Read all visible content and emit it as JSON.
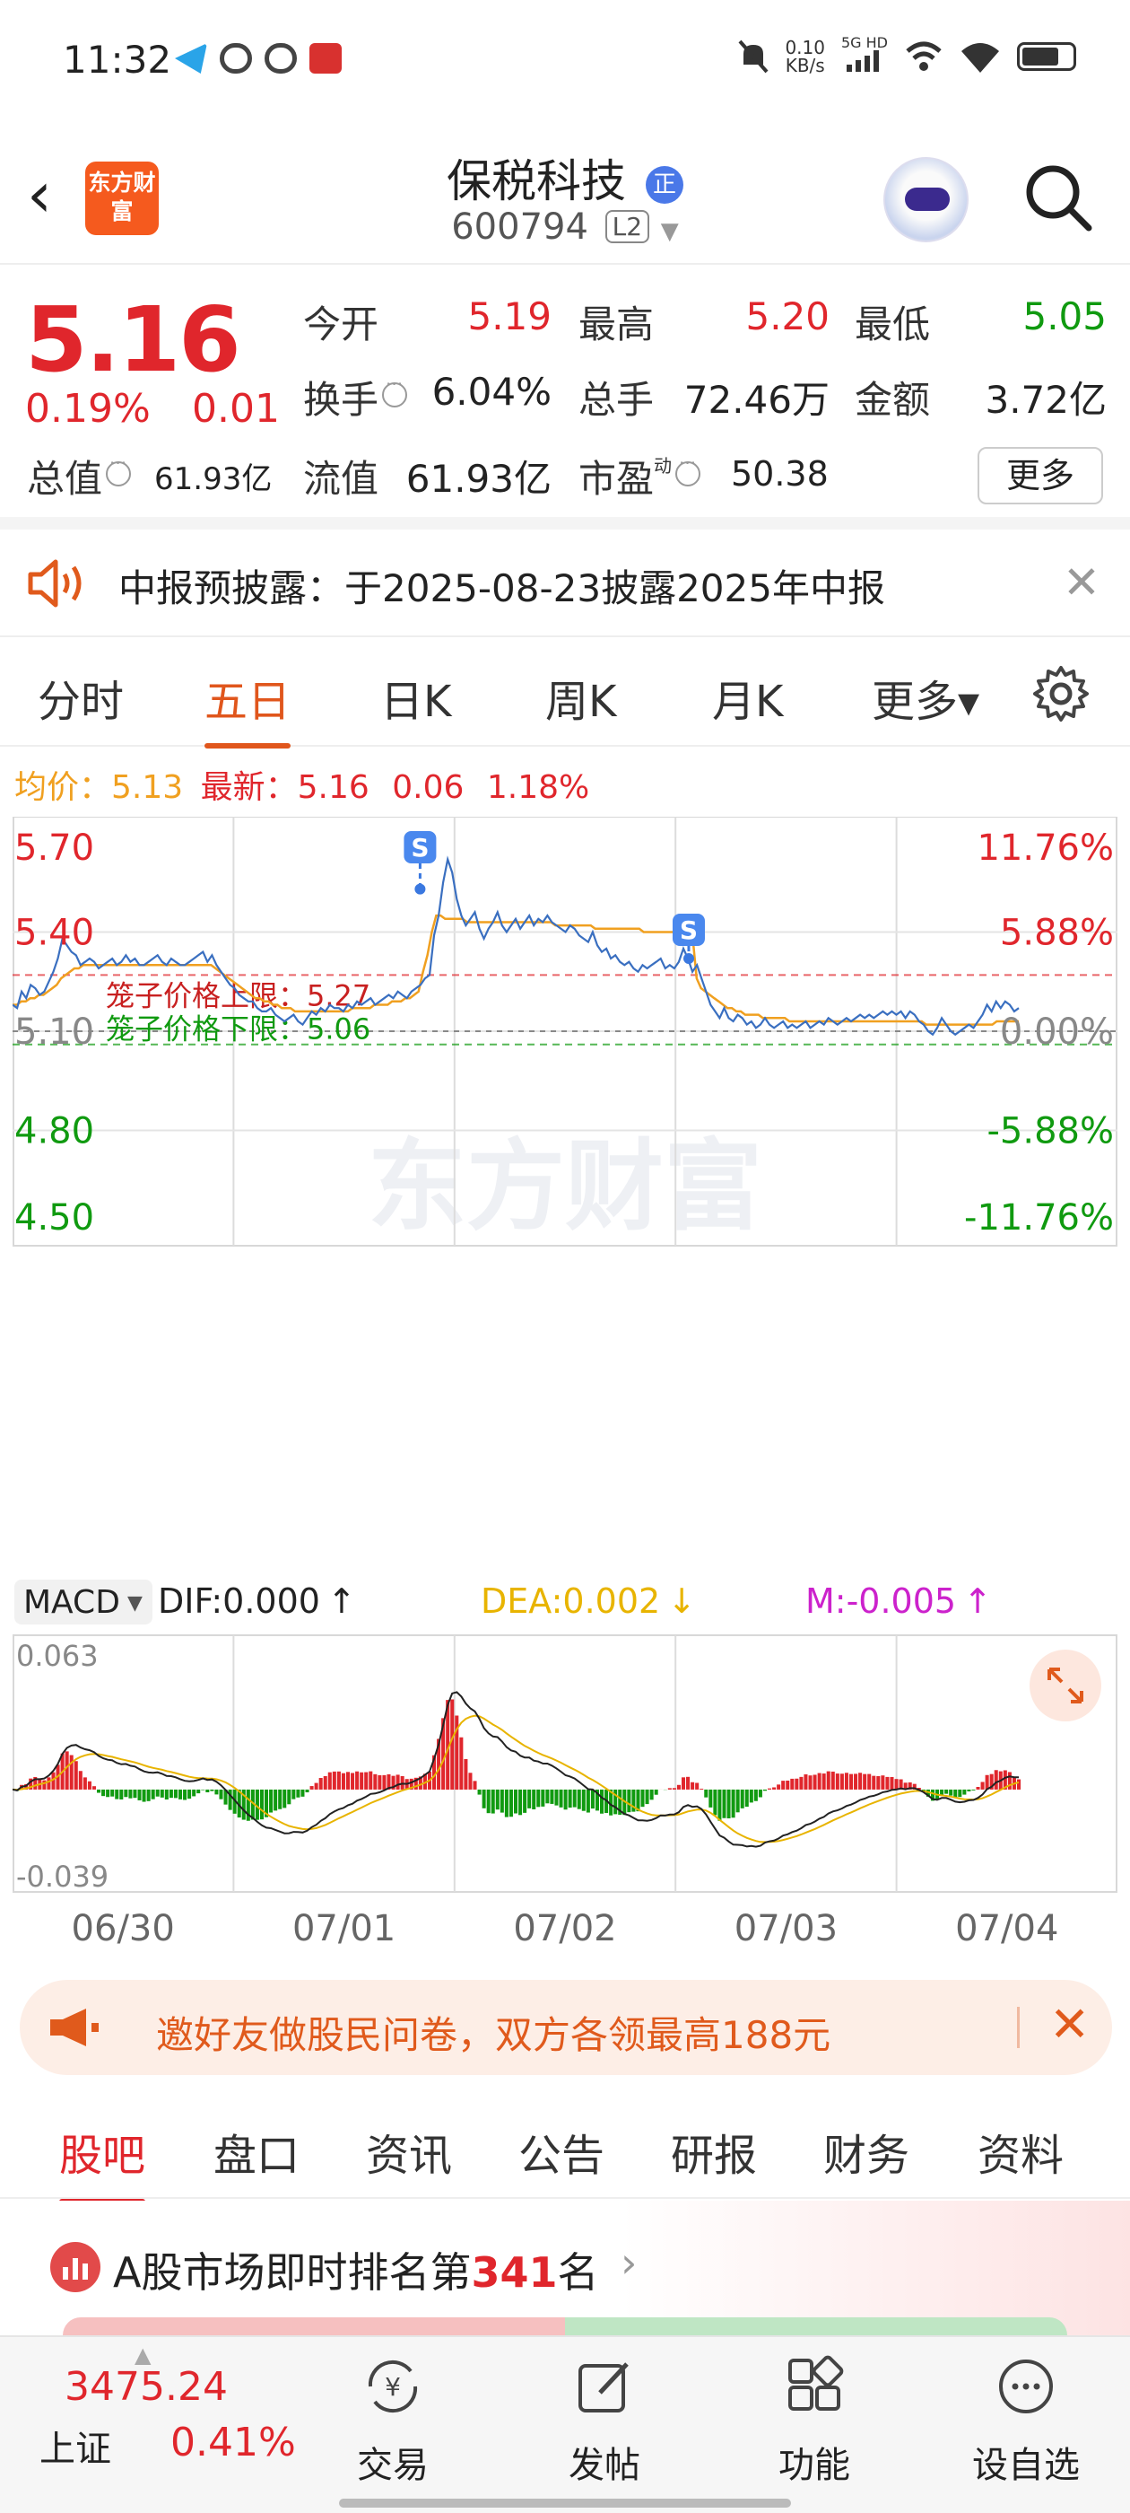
{
  "status_bar": {
    "time": "11:32",
    "net_speed": "0.10",
    "net_unit": "KB/s",
    "signal_label": "5G HD"
  },
  "header": {
    "logo_text": "东方财富",
    "stock_name": "保税科技",
    "name_badge": "正",
    "stock_code": "600794",
    "level_badge": "L2"
  },
  "quote": {
    "price": "5.16",
    "change_pct": "0.19%",
    "change_amt": "0.01",
    "open_label": "今开",
    "open_value": "5.19",
    "high_label": "最高",
    "high_value": "5.20",
    "low_label": "最低",
    "low_value": "5.05",
    "turnover_label": "换手",
    "turnover_value": "6.04%",
    "volume_label": "总手",
    "volume_value": "72.46万",
    "amount_label": "金额",
    "amount_value": "3.72亿",
    "mktcap_label": "总值",
    "mktcap_value": "61.93亿",
    "float_label": "流值",
    "float_value": "61.93亿",
    "pe_label": "市盈",
    "pe_sup": "动",
    "pe_value": "50.38",
    "more_button": "更多"
  },
  "notice": {
    "text": "中报预披露：于2025-08-23披露2025年中报"
  },
  "chart_tabs": {
    "items": [
      "分时",
      "五日",
      "日K",
      "周K",
      "月K",
      "更多▾"
    ],
    "active_index": 1
  },
  "avg_line": {
    "avg_label": "均价：",
    "avg_value": "5.13",
    "latest_label": "最新：",
    "latest_value": "5.16",
    "latest_change": "0.06",
    "latest_pct": "1.18%"
  },
  "chart_data": {
    "type": "line",
    "title": "",
    "x_dates": [
      "06/30",
      "07/01",
      "07/02",
      "07/03",
      "07/04"
    ],
    "price_axis": {
      "left_labels": [
        "5.70",
        "5.40",
        "5.10",
        "4.80",
        "4.50"
      ],
      "right_labels": [
        "11.76%",
        "5.88%",
        "0.00%",
        "-5.88%",
        "-11.76%"
      ],
      "ylim": [
        4.5,
        5.7
      ],
      "base": 5.1
    },
    "limit_up": {
      "label": "笼子价格上限：5.27",
      "value": 5.27
    },
    "limit_down": {
      "label": "笼子价格下限：5.06",
      "value": 5.06
    },
    "sell_markers": [
      {
        "label": "S",
        "day_index": 2,
        "price": 5.53
      },
      {
        "label": "S",
        "day_index": 2,
        "price": 5.32
      }
    ],
    "watermark": "东方财富",
    "series": [
      {
        "name": "价格",
        "color": "#3a6fc0",
        "values": [
          5.18,
          5.17,
          5.22,
          5.2,
          5.24,
          5.23,
          5.21,
          5.22,
          5.25,
          5.28,
          5.32,
          5.38,
          5.36,
          5.34,
          5.33,
          5.3,
          5.31,
          5.32,
          5.31,
          5.29,
          5.3,
          5.31,
          5.32,
          5.3,
          5.31,
          5.33,
          5.31,
          5.32,
          5.3,
          5.3,
          5.31,
          5.32,
          5.33,
          5.31,
          5.3,
          5.32,
          5.31,
          5.3,
          5.3,
          5.31,
          5.32,
          5.33,
          5.34,
          5.31,
          5.33,
          5.3,
          5.28,
          5.26,
          5.24,
          5.23,
          5.21,
          5.2,
          5.19,
          5.19,
          5.17,
          5.16,
          5.16,
          5.17,
          5.15,
          5.14,
          5.13,
          5.14,
          5.15,
          5.13,
          5.12,
          5.14,
          5.16,
          5.15,
          5.17,
          5.16,
          5.18,
          5.17,
          5.17,
          5.16,
          5.18,
          5.17,
          5.19,
          5.18,
          5.19,
          5.2,
          5.18,
          5.19,
          5.2,
          5.21,
          5.2,
          5.22,
          5.21,
          5.2,
          5.22,
          5.23,
          5.24,
          5.26,
          5.27,
          5.39,
          5.45,
          5.55,
          5.62,
          5.58,
          5.5,
          5.45,
          5.42,
          5.44,
          5.46,
          5.41,
          5.38,
          5.41,
          5.43,
          5.46,
          5.42,
          5.4,
          5.42,
          5.44,
          5.41,
          5.43,
          5.45,
          5.42,
          5.44,
          5.43,
          5.45,
          5.43,
          5.42,
          5.41,
          5.4,
          5.42,
          5.41,
          5.39,
          5.38,
          5.37,
          5.4,
          5.36,
          5.34,
          5.35,
          5.32,
          5.33,
          5.31,
          5.3,
          5.31,
          5.29,
          5.28,
          5.3,
          5.29,
          5.3,
          5.31,
          5.32,
          5.29,
          5.3,
          5.29,
          5.31,
          5.35,
          5.32,
          5.28,
          5.3,
          5.26,
          5.22,
          5.18,
          5.16,
          5.14,
          5.17,
          5.14,
          5.13,
          5.15,
          5.14,
          5.12,
          5.13,
          5.11,
          5.12,
          5.14,
          5.12,
          5.11,
          5.12,
          5.13,
          5.11,
          5.12,
          5.11,
          5.12,
          5.13,
          5.11,
          5.12,
          5.13,
          5.12,
          5.14,
          5.13,
          5.12,
          5.13,
          5.14,
          5.13,
          5.14,
          5.15,
          5.14,
          5.15,
          5.14,
          5.15,
          5.16,
          5.15,
          5.16,
          5.15,
          5.16,
          5.14,
          5.16,
          5.15,
          5.13,
          5.12,
          5.1,
          5.09,
          5.11,
          5.14,
          5.12,
          5.1,
          5.09,
          5.1,
          5.11,
          5.12,
          5.11,
          5.13,
          5.15,
          5.18,
          5.16,
          5.19,
          5.17,
          5.19,
          5.18,
          5.16,
          5.17
        ]
      },
      {
        "name": "均价",
        "color": "#f0a020",
        "values": [
          5.18,
          5.18,
          5.19,
          5.19,
          5.2,
          5.2,
          5.21,
          5.21,
          5.22,
          5.23,
          5.24,
          5.26,
          5.27,
          5.28,
          5.29,
          5.29,
          5.3,
          5.3,
          5.3,
          5.3,
          5.3,
          5.3,
          5.3,
          5.3,
          5.3,
          5.3,
          5.3,
          5.3,
          5.3,
          5.3,
          5.3,
          5.3,
          5.3,
          5.3,
          5.3,
          5.3,
          5.3,
          5.3,
          5.3,
          5.3,
          5.3,
          5.3,
          5.3,
          5.3,
          5.3,
          5.3,
          5.29,
          5.28,
          5.27,
          5.26,
          5.25,
          5.24,
          5.23,
          5.22,
          5.21,
          5.2,
          5.2,
          5.19,
          5.19,
          5.18,
          5.18,
          5.17,
          5.17,
          5.17,
          5.16,
          5.16,
          5.16,
          5.16,
          5.16,
          5.16,
          5.16,
          5.16,
          5.16,
          5.16,
          5.16,
          5.16,
          5.16,
          5.17,
          5.17,
          5.17,
          5.17,
          5.17,
          5.18,
          5.18,
          5.18,
          5.18,
          5.19,
          5.19,
          5.19,
          5.2,
          5.2,
          5.21,
          5.22,
          5.28,
          5.33,
          5.4,
          5.45,
          5.45,
          5.44,
          5.44,
          5.44,
          5.44,
          5.44,
          5.43,
          5.43,
          5.43,
          5.43,
          5.43,
          5.43,
          5.43,
          5.43,
          5.43,
          5.43,
          5.43,
          5.43,
          5.43,
          5.43,
          5.43,
          5.43,
          5.43,
          5.43,
          5.43,
          5.43,
          5.42,
          5.42,
          5.42,
          5.42,
          5.42,
          5.42,
          5.42,
          5.42,
          5.42,
          5.41,
          5.41,
          5.41,
          5.41,
          5.41,
          5.41,
          5.41,
          5.41,
          5.41,
          5.41,
          5.41,
          5.4,
          5.4,
          5.4,
          5.4,
          5.4,
          5.4,
          5.4,
          5.4,
          5.4,
          5.4,
          5.4,
          5.4,
          5.26,
          5.23,
          5.22,
          5.21,
          5.2,
          5.19,
          5.18,
          5.17,
          5.17,
          5.16,
          5.16,
          5.15,
          5.15,
          5.15,
          5.15,
          5.14,
          5.14,
          5.14,
          5.14,
          5.14,
          5.14,
          5.13,
          5.13,
          5.13,
          5.13,
          5.13,
          5.13,
          5.13,
          5.13,
          5.13,
          5.13,
          5.13,
          5.13,
          5.13,
          5.13,
          5.13,
          5.13,
          5.13,
          5.13,
          5.13,
          5.13,
          5.13,
          5.13,
          5.13,
          5.13,
          5.13,
          5.13,
          5.13,
          5.13,
          5.13,
          5.13,
          5.13,
          5.12,
          5.12,
          5.12,
          5.12,
          5.12,
          5.12,
          5.12,
          5.12,
          5.12,
          5.12,
          5.12,
          5.12,
          5.12,
          5.12,
          5.12,
          5.12,
          5.13,
          5.13,
          5.13,
          5.13,
          5.13,
          5.13
        ]
      }
    ],
    "macd": {
      "indicator": "MACD",
      "dif_label": "DIF:0.000",
      "dif_arrow": "↑",
      "dea_label": "DEA:0.002",
      "dea_arrow": "↓",
      "m_label": "M:-0.005",
      "m_arrow": "↑",
      "y_top": "0.063",
      "y_bottom": "-0.039",
      "ylim": [
        -0.039,
        0.063
      ],
      "colors": {
        "dif": "#222222",
        "dea": "#e8b400",
        "up": "#e0262c",
        "down": "#109a10"
      }
    }
  },
  "ad_banner": {
    "text": "邀好友做股民问卷，双方各领最高188元"
  },
  "bottom_tabs": {
    "items": [
      "股吧",
      "盘口",
      "资讯",
      "公告",
      "研报",
      "财务",
      "资料"
    ],
    "active_index": 0
  },
  "rank": {
    "prefix": "A股市场即时排名第",
    "number": "341",
    "suffix": "名"
  },
  "bottom_nav": {
    "index_value": "3475.24",
    "index_name": "上证",
    "index_pct": "0.41%",
    "items": [
      "交易",
      "发帖",
      "功能",
      "设自选"
    ]
  },
  "colors": {
    "up": "#e0262c",
    "down": "#109a10",
    "accent": "#e0561c",
    "price_line": "#3a6fc0",
    "avg_line": "#f0a020"
  }
}
